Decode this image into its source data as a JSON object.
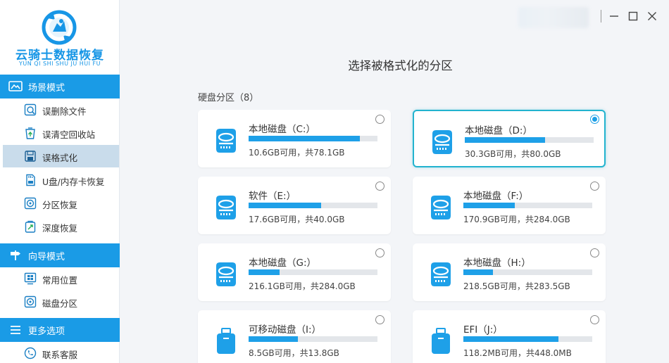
{
  "app": {
    "title": "云骑士数据恢复",
    "subtitle": "YUN QI SHI SHU JU HUI FU",
    "brand_color": "#1a9be6"
  },
  "sidebar": {
    "sections": [
      {
        "title": "场景模式",
        "icon": "scene-mode-icon",
        "items": [
          {
            "label": "误删除文件",
            "icon": "deleted-file-icon",
            "active": false
          },
          {
            "label": "误清空回收站",
            "icon": "recycle-bin-icon",
            "active": false
          },
          {
            "label": "误格式化",
            "icon": "format-disk-icon",
            "active": true
          },
          {
            "label": "U盘/内存卡恢复",
            "icon": "usb-card-icon",
            "active": false
          },
          {
            "label": "分区恢复",
            "icon": "partition-recovery-icon",
            "active": false
          },
          {
            "label": "深度恢复",
            "icon": "deep-recovery-icon",
            "active": false
          }
        ]
      },
      {
        "title": "向导模式",
        "icon": "signpost-icon",
        "items": [
          {
            "label": "常用位置",
            "icon": "windows-icon",
            "active": false
          },
          {
            "label": "磁盘分区",
            "icon": "disk-partition-icon",
            "active": false
          }
        ]
      },
      {
        "title": "更多选项",
        "icon": "menu-lines-icon",
        "items": [
          {
            "label": "联系客服",
            "icon": "customer-service-icon",
            "active": false
          }
        ]
      }
    ]
  },
  "main": {
    "title": "选择被格式化的分区",
    "section_label": "硬盘分区（8）",
    "window_controls": [
      "minimize-icon",
      "maximize-icon",
      "close-icon"
    ],
    "partitions": [
      {
        "name": "本地磁盘（C:）",
        "size": "10.6GB可用，共78.1GB",
        "used_fraction": 0.864,
        "type": "disk",
        "selected": false
      },
      {
        "name": "本地磁盘（D:）",
        "size": "30.3GB可用，共80.0GB",
        "used_fraction": 0.621,
        "type": "disk",
        "selected": true
      },
      {
        "name": "软件（E:）",
        "size": "17.6GB可用，共40.0GB",
        "used_fraction": 0.56,
        "type": "disk",
        "selected": false
      },
      {
        "name": "本地磁盘（F:）",
        "size": "170.9GB可用，共284.0GB",
        "used_fraction": 0.398,
        "type": "disk",
        "selected": false
      },
      {
        "name": "本地磁盘（G:）",
        "size": "216.1GB可用，共284.0GB",
        "used_fraction": 0.239,
        "type": "disk",
        "selected": false
      },
      {
        "name": "本地磁盘（H:）",
        "size": "218.5GB可用，共283.5GB",
        "used_fraction": 0.229,
        "type": "disk",
        "selected": false
      },
      {
        "name": "可移动磁盘（I:）",
        "size": "8.5GB可用，共13.8GB",
        "used_fraction": 0.384,
        "type": "usb",
        "selected": false
      },
      {
        "name": "EFI（J:）",
        "size": "118.2MB可用，共448.0MB",
        "used_fraction": 0.736,
        "type": "usb",
        "selected": false
      }
    ]
  }
}
